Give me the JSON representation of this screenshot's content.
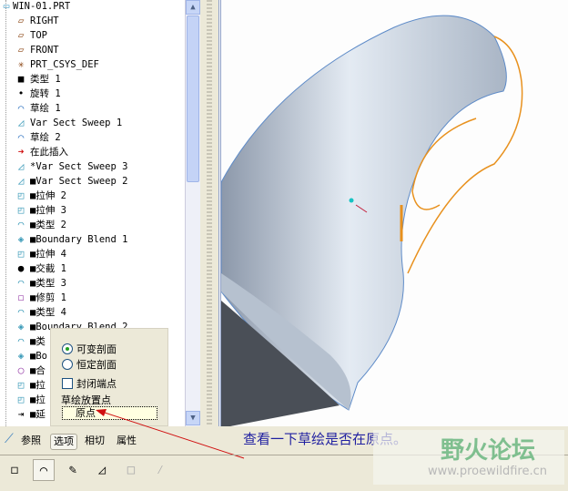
{
  "tree": {
    "items": [
      {
        "label": "WIN-01.PRT",
        "icon": "part-icon"
      },
      {
        "label": "RIGHT",
        "icon": "datum-plane-icon"
      },
      {
        "label": "TOP",
        "icon": "datum-plane-icon"
      },
      {
        "label": "FRONT",
        "icon": "datum-plane-icon"
      },
      {
        "label": "PRT_CSYS_DEF",
        "icon": "csys-icon"
      },
      {
        "label": "类型 1",
        "icon": "feature-icon"
      },
      {
        "label": "旋转 1",
        "icon": "revolve-icon"
      },
      {
        "label": "草绘 1",
        "icon": "sketch-icon"
      },
      {
        "label": "Var Sect Sweep 1",
        "icon": "sweep-icon"
      },
      {
        "label": "草绘 2",
        "icon": "sketch-icon"
      },
      {
        "label": "在此插入",
        "icon": "insert-arrow-icon"
      },
      {
        "label": "*Var Sect Sweep 3",
        "icon": "sweep-icon"
      },
      {
        "label": "■Var Sect Sweep 2",
        "icon": "sweep-icon"
      },
      {
        "label": "■拉伸 2",
        "icon": "extrude-icon"
      },
      {
        "label": "■拉伸 3",
        "icon": "extrude-icon"
      },
      {
        "label": "■类型 2",
        "icon": "surface-icon"
      },
      {
        "label": "■Boundary Blend 1",
        "icon": "blend-icon"
      },
      {
        "label": "■拉伸 4",
        "icon": "extrude-icon"
      },
      {
        "label": "■交截 1",
        "icon": "intersect-icon"
      },
      {
        "label": "■类型 3",
        "icon": "surface-icon"
      },
      {
        "label": "■修剪 1",
        "icon": "trim-icon"
      },
      {
        "label": "■类型 4",
        "icon": "surface-icon"
      },
      {
        "label": "■Boundary Blend 2",
        "icon": "blend-icon"
      },
      {
        "label": "■类",
        "icon": "surface-icon"
      },
      {
        "label": "■Bo",
        "icon": "blend-icon"
      },
      {
        "label": "■合",
        "icon": "merge-icon"
      },
      {
        "label": "■拉",
        "icon": "extrude-icon"
      },
      {
        "label": "■拉",
        "icon": "extrude-icon"
      },
      {
        "label": "■延",
        "icon": "extend-icon"
      }
    ]
  },
  "popup": {
    "variable_section": "可变剖面",
    "constant_section": "恒定剖面",
    "cap_ends": "封闭端点",
    "sketch_placement_label": "草绘放置点",
    "sketch_placement_value": "原点",
    "selected": "variable_section",
    "cap_ends_checked": false
  },
  "tabs": [
    {
      "label": "参照"
    },
    {
      "label": "选项",
      "active": true
    },
    {
      "label": "相切"
    },
    {
      "label": "属性"
    }
  ],
  "toolbar": [
    "solid-icon",
    "surface-icon",
    "sketch-edit-icon",
    "remove-material-icon",
    "thicken-icon",
    "feature-mode-icon"
  ],
  "annotation": "查看一下草绘是否在原点。",
  "watermark": {
    "title": "野火论坛",
    "url": "www.proewildfire.cn"
  },
  "colors": {
    "accent": "#1f1fa0",
    "trajectory": "#e8911e",
    "model": "#b8c4d4"
  }
}
